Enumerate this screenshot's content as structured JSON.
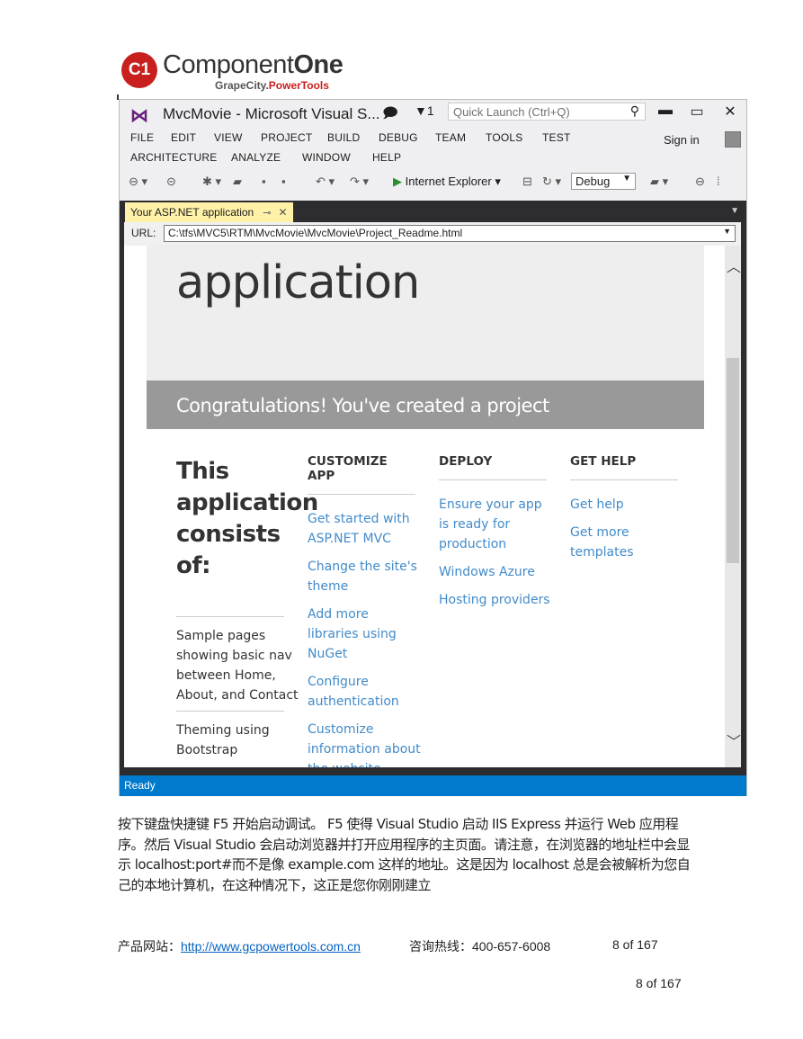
{
  "logo": {
    "badge": "C1",
    "name_regular": "Component",
    "name_bold": "One",
    "sub_regular": "GrapeCity.",
    "sub_brand": "PowerTools"
  },
  "vs": {
    "title": "MvcMovie - Microsoft Visual S...",
    "filter_count": "1",
    "quick_launch_placeholder": "Quick Launch (Ctrl+Q)",
    "menu_row1": [
      "FILE",
      "EDIT",
      "VIEW",
      "PROJECT",
      "BUILD",
      "DEBUG",
      "TEAM",
      "TOOLS",
      "TEST"
    ],
    "menu_row2": [
      "ARCHITECTURE",
      "ANALYZE",
      "WINDOW",
      "HELP"
    ],
    "sign_in": "Sign in",
    "run_target": "Internet Explorer",
    "config": "Debug",
    "doc_tab": "Your ASP.NET application",
    "url_label": "URL:",
    "url": "C:\\tfs\\MVC5\\RTM\\MvcMovie\\MvcMovie\\Project_Readme.html",
    "status": "Ready"
  },
  "page": {
    "jumbo_title": "application",
    "congrats": "Congratulations! You've created a project",
    "intro_heading": "This application consists of:",
    "intro_items": [
      "Sample pages showing basic nav between Home, About, and Contact",
      "Theming using Bootstrap"
    ],
    "columns": [
      {
        "heading": "CUSTOMIZE APP",
        "links": [
          "Get started with ASP.NET MVC",
          "Change the site's theme",
          "Add more libraries using NuGet",
          "Configure authentication",
          "Customize information about the website"
        ]
      },
      {
        "heading": "DEPLOY",
        "links": [
          "Ensure your app is ready for production",
          "Windows Azure",
          "Hosting providers"
        ]
      },
      {
        "heading": "GET HELP",
        "links": [
          "Get help",
          "Get more templates"
        ]
      }
    ]
  },
  "document": {
    "paragraph": "按下键盘快捷键 F5 开始启动调试。 F5 使得 Visual Studio 启动 IIS Express 并运行 Web 应用程序。然后 Visual Studio 会启动浏览器并打开应用程序的主页面。请注意，在浏览器的地址栏中会显示 localhost:port#而不是像 example.com 这样的地址。这是因为 localhost 总是会被解析为您自己的本地计算机，在这种情况下，这正是您你刚刚建立",
    "footer_site_label": "产品网站：",
    "footer_site_url": "http://www.gcpowertools.com.cn",
    "footer_hotline": "咨询热线：400-657-6008",
    "footer_page": "8 of 167",
    "page_number": "8 of 167"
  }
}
